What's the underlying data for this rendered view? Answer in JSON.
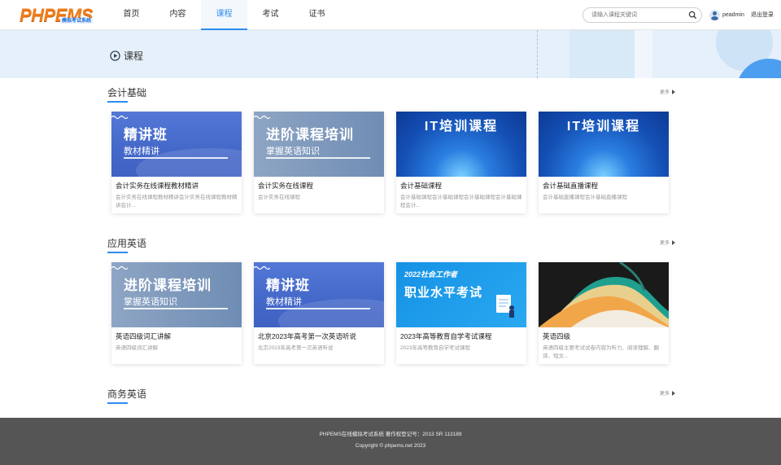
{
  "header": {
    "logo_text": "PHPEMS",
    "logo_subtitle": "模拟考试系统",
    "nav": [
      "首页",
      "内容",
      "课程",
      "考试",
      "证书"
    ],
    "active_nav_index": 2,
    "search_placeholder": "请输入课程关键词",
    "username": "peadmin",
    "logout_label": "退出登录"
  },
  "banner": {
    "title": "课程"
  },
  "sections": [
    {
      "title": "会计基础",
      "more_label": "更多",
      "cards": [
        {
          "thumb_style": "blue",
          "thumb_big": "精讲班",
          "thumb_small": "教材精讲",
          "title": "会计实务在线课程教材精讲",
          "desc": "会计实务在线课程教材精讲会计实务在线课程教材精讲会计..."
        },
        {
          "thumb_style": "gray",
          "thumb_big": "进阶课程培训",
          "thumb_small": "掌握英语知识",
          "title": "会计实务在线课程",
          "desc": "会计实务在线课程"
        },
        {
          "thumb_style": "it",
          "thumb_big": "IT培训课程",
          "thumb_small": "",
          "title": "会计基础课程",
          "desc": "会计基础课程会计基础课程会计基础课程会计基础课程会计..."
        },
        {
          "thumb_style": "it",
          "thumb_big": "IT培训课程",
          "thumb_small": "",
          "title": "会计基础直播课程",
          "desc": "会计基础直播课程会计基础直播课程"
        }
      ]
    },
    {
      "title": "应用英语",
      "more_label": "更多",
      "cards": [
        {
          "thumb_style": "gray",
          "thumb_big": "进阶课程培训",
          "thumb_small": "掌握英语知识",
          "title": "英语四级词汇讲解",
          "desc": "英语四级词汇讲解"
        },
        {
          "thumb_style": "blue",
          "thumb_big": "精讲班",
          "thumb_small": "教材精讲",
          "title": "北京2023年高考第一次英语听说",
          "desc": "北京2023年高考第一次英语听说"
        },
        {
          "thumb_style": "green",
          "thumb_big": "职业水平考试",
          "thumb_small": "2022社会工作者",
          "title": "2023年高等教育自学考试课程",
          "desc": "2023年高等教育自学考试课程"
        },
        {
          "thumb_style": "dark",
          "thumb_big": "",
          "thumb_small": "",
          "title": "英语四级",
          "desc": "英语四级主要考试试卷内容为听力、阅读理解、翻译、短文..."
        }
      ]
    },
    {
      "title": "商务英语",
      "more_label": "更多",
      "cards": []
    }
  ],
  "footer": {
    "line1": "PHPEMS在线模拟考试系统 著作权登记号：2013 SR 113189",
    "line2": "Copyright © phpems.net 2023"
  }
}
